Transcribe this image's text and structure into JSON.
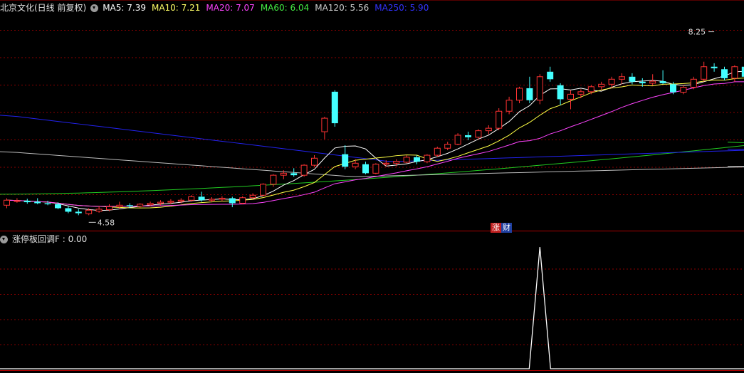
{
  "header": {
    "title": "北京文化(日线 前复权)",
    "ma_labels": [
      {
        "text": "MA5: 7.39",
        "color": "#ffffff"
      },
      {
        "text": "MA10: 7.21",
        "color": "#ffff66"
      },
      {
        "text": "MA20: 7.07",
        "color": "#ff44ff"
      },
      {
        "text": "MA60: 6.04",
        "color": "#44ee44"
      },
      {
        "text": "MA120: 5.56",
        "color": "#cccccc"
      },
      {
        "text": "MA250: 5.90",
        "color": "#3333ff"
      }
    ]
  },
  "indicator": {
    "title": "涨停板回调F : 0.00"
  },
  "badges": [
    {
      "text": "涨",
      "bg": "#c02020"
    },
    {
      "text": "财",
      "bg": "#2040a0"
    }
  ],
  "colors": {
    "up": "#ff3333",
    "down": "#44ffff",
    "grid": "#8b0000",
    "signal": "#ffffff"
  },
  "chart_data": [
    {
      "type": "candlestick",
      "title": "北京文化(日线 前复权)",
      "ylim": [
        4.3,
        8.6
      ],
      "annotations": [
        {
          "text": "8.25",
          "index": 69,
          "value": 8.25
        },
        {
          "text": "4.58",
          "index": 8,
          "value": 4.58
        }
      ],
      "candles": [
        [
          4.78,
          4.92,
          4.72,
          4.88
        ],
        [
          4.86,
          4.92,
          4.83,
          4.87
        ],
        [
          4.87,
          4.91,
          4.81,
          4.84
        ],
        [
          4.85,
          4.92,
          4.8,
          4.82
        ],
        [
          4.82,
          4.87,
          4.78,
          4.8
        ],
        [
          4.8,
          4.84,
          4.7,
          4.72
        ],
        [
          4.72,
          4.76,
          4.62,
          4.65
        ],
        [
          4.65,
          4.7,
          4.58,
          4.62
        ],
        [
          4.61,
          4.72,
          4.58,
          4.68
        ],
        [
          4.66,
          4.76,
          4.63,
          4.7
        ],
        [
          4.69,
          4.8,
          4.66,
          4.75
        ],
        [
          4.75,
          4.85,
          4.7,
          4.78
        ],
        [
          4.78,
          4.82,
          4.72,
          4.76
        ],
        [
          4.76,
          4.82,
          4.73,
          4.8
        ],
        [
          4.79,
          4.85,
          4.76,
          4.82
        ],
        [
          4.82,
          4.88,
          4.78,
          4.84
        ],
        [
          4.84,
          4.9,
          4.8,
          4.86
        ],
        [
          4.86,
          4.92,
          4.82,
          4.88
        ],
        [
          4.88,
          4.98,
          4.85,
          4.95
        ],
        [
          4.95,
          5.05,
          4.85,
          4.88
        ],
        [
          4.88,
          4.94,
          4.84,
          4.9
        ],
        [
          4.9,
          4.96,
          4.86,
          4.92
        ],
        [
          4.92,
          4.95,
          4.74,
          4.82
        ],
        [
          4.82,
          4.96,
          4.8,
          4.93
        ],
        [
          4.93,
          5.02,
          4.9,
          4.98
        ],
        [
          4.98,
          5.22,
          4.96,
          5.2
        ],
        [
          5.2,
          5.4,
          5.15,
          5.38
        ],
        [
          5.38,
          5.48,
          5.3,
          5.42
        ],
        [
          5.42,
          5.52,
          5.35,
          5.38
        ],
        [
          5.38,
          5.6,
          5.35,
          5.58
        ],
        [
          5.58,
          5.78,
          5.55,
          5.72
        ],
        [
          6.25,
          6.55,
          6.1,
          6.52
        ],
        [
          7.05,
          7.08,
          6.35,
          6.42
        ],
        [
          5.8,
          5.98,
          5.5,
          5.55
        ],
        [
          5.55,
          5.7,
          5.5,
          5.62
        ],
        [
          5.6,
          5.65,
          5.4,
          5.42
        ],
        [
          5.42,
          5.62,
          5.4,
          5.6
        ],
        [
          5.6,
          5.68,
          5.55,
          5.62
        ],
        [
          5.62,
          5.7,
          5.56,
          5.66
        ],
        [
          5.64,
          5.78,
          5.62,
          5.74
        ],
        [
          5.74,
          5.78,
          5.6,
          5.65
        ],
        [
          5.65,
          5.8,
          5.62,
          5.78
        ],
        [
          5.78,
          5.95,
          5.75,
          5.92
        ],
        [
          5.92,
          6.05,
          5.88,
          6.0
        ],
        [
          6.0,
          6.22,
          5.98,
          6.18
        ],
        [
          6.18,
          6.25,
          6.08,
          6.14
        ],
        [
          6.14,
          6.3,
          6.1,
          6.27
        ],
        [
          6.27,
          6.38,
          6.2,
          6.32
        ],
        [
          6.32,
          6.72,
          6.28,
          6.66
        ],
        [
          6.66,
          6.95,
          6.6,
          6.88
        ],
        [
          6.88,
          7.15,
          6.82,
          7.12
        ],
        [
          7.12,
          7.35,
          6.82,
          6.88
        ],
        [
          6.88,
          7.4,
          6.8,
          7.35
        ],
        [
          7.45,
          7.55,
          7.25,
          7.3
        ],
        [
          7.18,
          7.22,
          6.78,
          6.9
        ],
        [
          6.9,
          7.08,
          6.7,
          7.0
        ],
        [
          7.0,
          7.1,
          6.92,
          7.05
        ],
        [
          7.05,
          7.18,
          7.0,
          7.15
        ],
        [
          7.15,
          7.25,
          7.08,
          7.2
        ],
        [
          7.2,
          7.35,
          7.12,
          7.3
        ],
        [
          7.3,
          7.42,
          7.2,
          7.35
        ],
        [
          7.35,
          7.42,
          7.2,
          7.25
        ],
        [
          7.25,
          7.32,
          7.15,
          7.22
        ],
        [
          7.22,
          7.4,
          7.18,
          7.26
        ],
        [
          7.26,
          7.48,
          7.2,
          7.22
        ],
        [
          7.2,
          7.25,
          7.0,
          7.04
        ],
        [
          7.04,
          7.18,
          7.0,
          7.14
        ],
        [
          7.14,
          7.35,
          7.1,
          7.3
        ],
        [
          7.3,
          7.65,
          7.25,
          7.55
        ],
        [
          7.55,
          7.62,
          7.45,
          7.52
        ],
        [
          7.5,
          7.55,
          7.28,
          7.32
        ],
        [
          7.32,
          7.58,
          7.25,
          7.55
        ],
        [
          7.55,
          7.6,
          7.3,
          7.35
        ],
        [
          7.35,
          7.8,
          7.2,
          7.75
        ],
        [
          7.75,
          8.25,
          7.7,
          7.9
        ],
        [
          7.82,
          8.0,
          7.6,
          7.76
        ]
      ],
      "ma_periods": [
        5,
        10,
        20,
        60,
        120,
        250
      ],
      "ma_long_endpoints": {
        "MA60": [
          5.0,
          6.04
        ],
        "MA120": [
          5.85,
          5.56
        ],
        "MA250": [
          6.58,
          5.9
        ]
      }
    },
    {
      "type": "line",
      "title": "涨停板回调F",
      "ylim": [
        0,
        1
      ],
      "spike_index": 52,
      "values_note_free": true
    }
  ]
}
